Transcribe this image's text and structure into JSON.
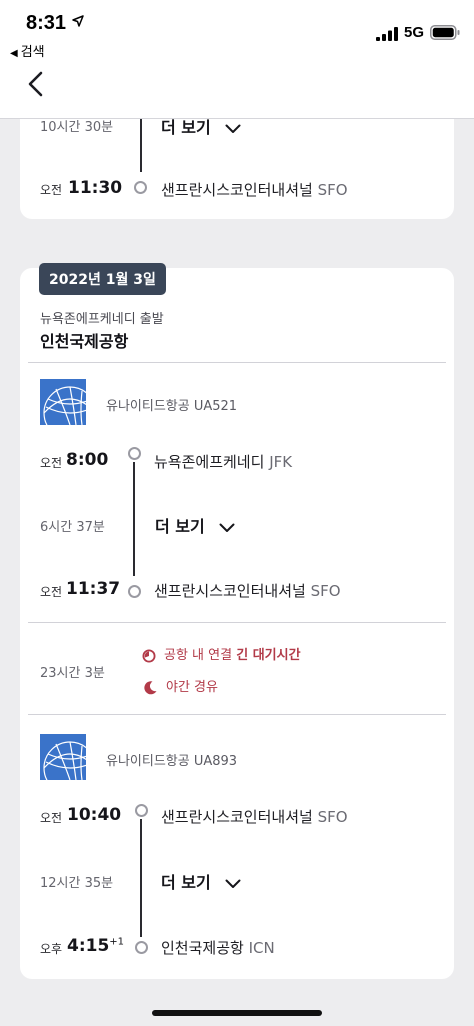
{
  "status_bar": {
    "time": "8:31",
    "back_app": "검색",
    "network": "5G"
  },
  "colors": {
    "accent_warning": "#b23a48",
    "badge_bg": "#3a4658",
    "page_bg": "#ededef"
  },
  "segment_prev": {
    "duration": "10시간 30분",
    "more_label": "더 보기",
    "arrival": {
      "ampm": "오전",
      "time": "11:30",
      "airport": "샌프란시스코인터내셔널",
      "code": "SFO"
    }
  },
  "journey": {
    "date": "2022년 1월 3일",
    "departure_label": "뉴욕존에프케네디 출발",
    "destination": "인천국제공항",
    "flights": [
      {
        "airline": "유나이티드항공 UA521",
        "departure": {
          "ampm": "오전",
          "time": "8:00",
          "airport": "뉴욕존에프케네디",
          "code": "JFK"
        },
        "duration": "6시간 37분",
        "more_label": "더 보기",
        "arrival": {
          "ampm": "오전",
          "time": "11:37",
          "airport": "샌프란시스코인터내셔널",
          "code": "SFO"
        }
      },
      {
        "airline": "유나이티드항공 UA893",
        "departure": {
          "ampm": "오전",
          "time": "10:40",
          "airport": "샌프란시스코인터내셔널",
          "code": "SFO"
        },
        "duration": "12시간 35분",
        "more_label": "더 보기",
        "arrival": {
          "ampm": "오후",
          "time": "4:15",
          "day_offset": "+1",
          "airport": "인천국제공항",
          "code": "ICN"
        }
      }
    ],
    "layover": {
      "duration": "23시간 3분",
      "warning_prefix": "공항 내 연결",
      "warning_bold": "긴 대기시간",
      "overnight": "야간 경유"
    }
  }
}
